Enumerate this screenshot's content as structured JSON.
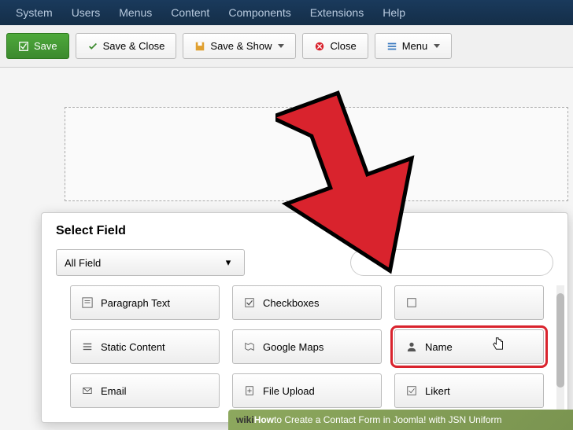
{
  "topnav": {
    "items": [
      "System",
      "Users",
      "Menus",
      "Content",
      "Components",
      "Extensions",
      "Help"
    ]
  },
  "toolbar": {
    "save": "Save",
    "save_close": "Save & Close",
    "save_show": "Save & Show",
    "close": "Close",
    "menu": "Menu"
  },
  "modal": {
    "title": "Select Field",
    "filter_label": "All Field",
    "search_placeholder": "",
    "fields": [
      {
        "icon": "paragraph",
        "label": "Paragraph Text"
      },
      {
        "icon": "checkbox",
        "label": "Checkboxes"
      },
      {
        "icon": "hidden",
        "label": ""
      },
      {
        "icon": "static",
        "label": "Static Content"
      },
      {
        "icon": "map",
        "label": "Google Maps"
      },
      {
        "icon": "name",
        "label": "Name"
      },
      {
        "icon": "email",
        "label": "Email"
      },
      {
        "icon": "file",
        "label": "File Upload"
      },
      {
        "icon": "likert",
        "label": "Likert"
      }
    ]
  },
  "footer": {
    "brand_wiki": "wiki",
    "brand_how": "How",
    "text": " to Create a Contact Form in Joomla! with JSN Uniform"
  }
}
